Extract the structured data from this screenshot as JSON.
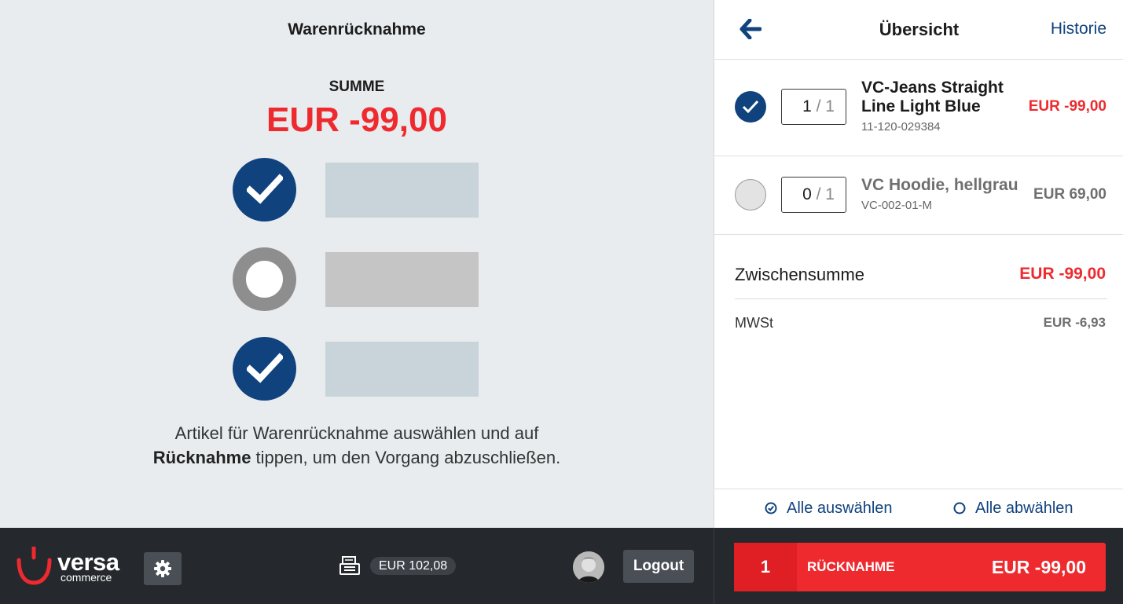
{
  "left": {
    "title": "Warenrücknahme",
    "sum_label": "SUMME",
    "sum_value": "EUR -99,00",
    "instructions_line1": "Artikel für Warenrücknahme auswählen und auf",
    "instructions_bold": "Rücknahme",
    "instructions_line2_rest": " tippen, um den Vorgang abzuschließen."
  },
  "overview": {
    "title": "Übersicht",
    "history_label": "Historie",
    "items": [
      {
        "name": "VC-Jeans Straight Line Light Blue",
        "sku": "11-120-029384",
        "qty": "1",
        "qty_max": "/ 1",
        "price": "EUR -99,00",
        "selected": true
      },
      {
        "name": "VC Hoodie, hellgrau",
        "sku": "VC-002-01-M",
        "qty": "0",
        "qty_max": "/ 1",
        "price": "EUR 69,00",
        "selected": false
      }
    ],
    "subtotal_label": "Zwischensumme",
    "subtotal_value": "EUR -99,00",
    "tax_label": "MWSt",
    "tax_value": "EUR -6,93",
    "select_all": "Alle auswählen",
    "deselect_all": "Alle abwählen"
  },
  "footer": {
    "logo_text": "versa",
    "logo_subtext": "commerce",
    "balance": "EUR 102,08",
    "logout_label": "Logout",
    "return_count": "1",
    "return_label": "RÜCKNAHME",
    "return_amount": "EUR -99,00"
  },
  "colors": {
    "accent_blue": "#10427e",
    "accent_red": "#ee2a2f",
    "footer_bg": "#25282d"
  }
}
